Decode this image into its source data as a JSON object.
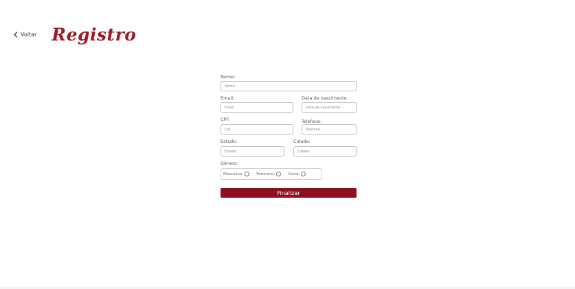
{
  "header": {
    "back_label": "Voltar",
    "title": "Registro",
    "back_icon": "chevron-left-icon"
  },
  "form": {
    "nome": {
      "label": "Nome:",
      "placeholder": "Nome"
    },
    "email": {
      "label": "Email:",
      "placeholder": "Email"
    },
    "nascimento": {
      "label": "Data de nascimento:",
      "placeholder": "Data de nascimento"
    },
    "cpf": {
      "label": "CPF:",
      "placeholder": "Cpf"
    },
    "telefone": {
      "label": "Telefone:",
      "placeholder": "Telefone"
    },
    "estado": {
      "label": "Estado:",
      "placeholder": "Estado"
    },
    "cidade": {
      "label": "Cidade:",
      "placeholder": "Cidade"
    },
    "genero": {
      "label": "Gênero:",
      "options": [
        "Masculino:",
        "Feminino:",
        "Outro:"
      ]
    },
    "submit_label": "Finalizar"
  },
  "colors": {
    "title": "#9b1b27",
    "button": "#8e0f1f"
  }
}
